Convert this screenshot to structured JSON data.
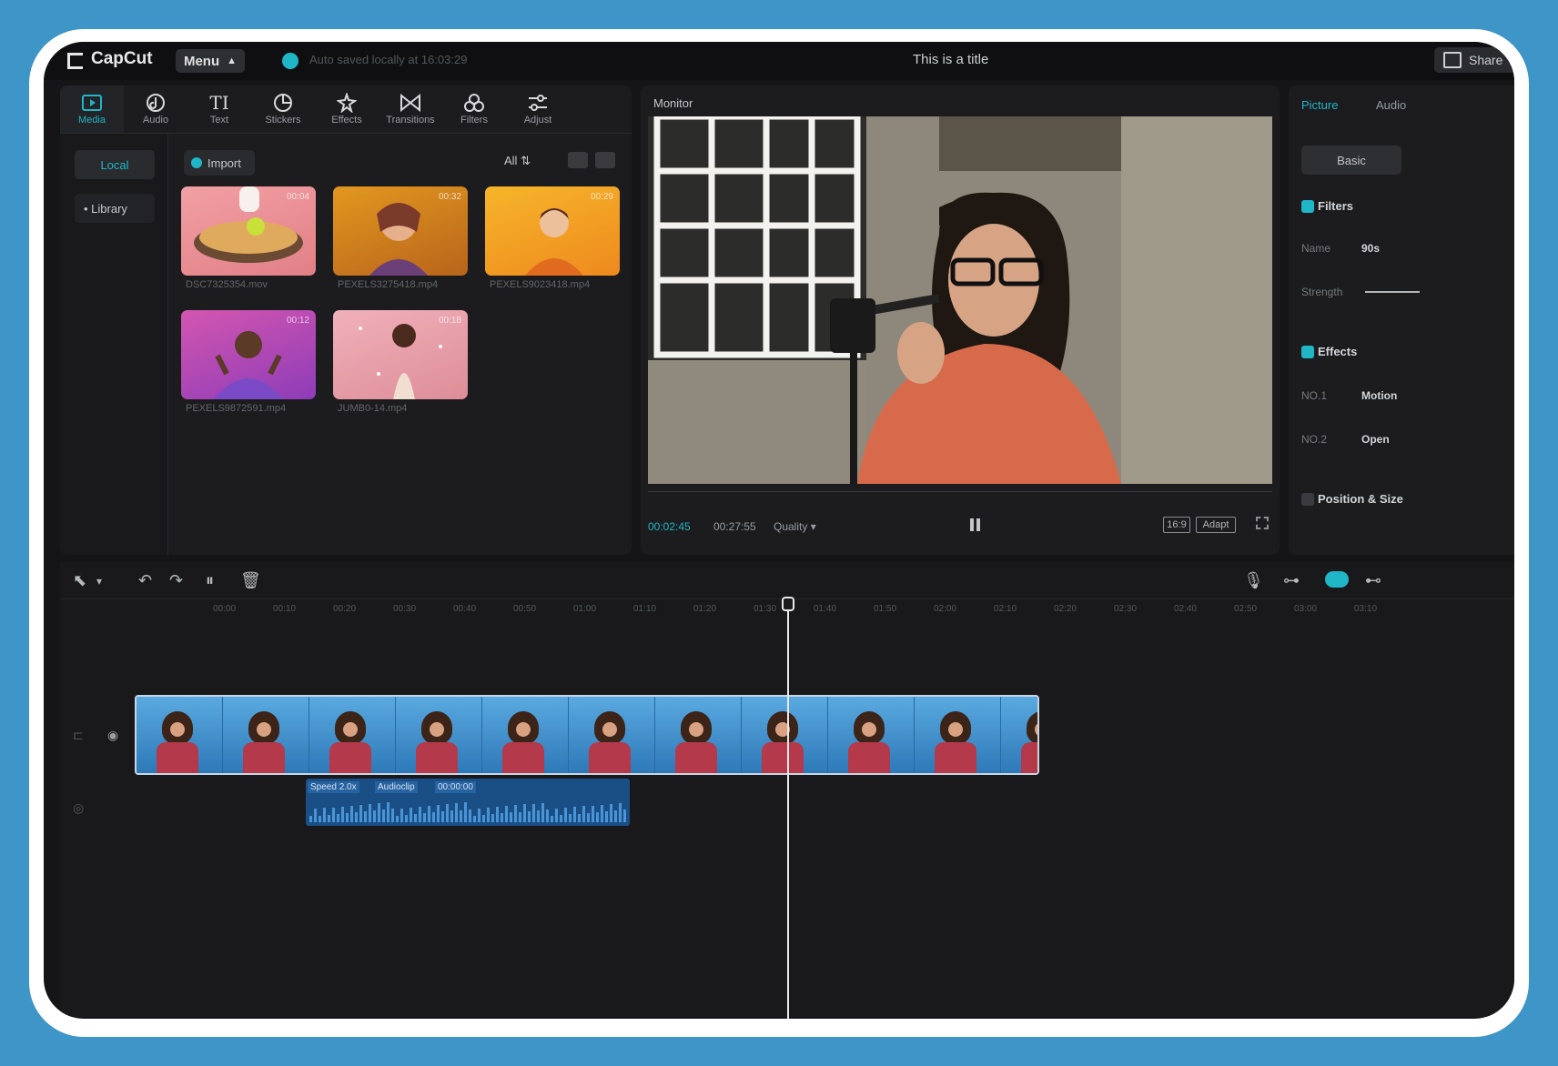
{
  "app": {
    "name": "CapCut",
    "menu_label": "Menu",
    "save_status": "Auto saved locally at 16:03:29",
    "project_title": "This is a title",
    "share_label": "Share"
  },
  "toolbar": {
    "items": [
      {
        "label": "Media",
        "icon": "media-icon"
      },
      {
        "label": "Audio",
        "icon": "audio-icon"
      },
      {
        "label": "Text",
        "icon": "text-icon"
      },
      {
        "label": "Stickers",
        "icon": "stickers-icon"
      },
      {
        "label": "Effects",
        "icon": "effects-icon"
      },
      {
        "label": "Transitions",
        "icon": "transitions-icon"
      },
      {
        "label": "Filters",
        "icon": "filters-icon"
      },
      {
        "label": "Adjust",
        "icon": "adjust-icon"
      }
    ],
    "active": "Media"
  },
  "media": {
    "tabs": {
      "local": "Local",
      "library": "• Library"
    },
    "import_label": "Import",
    "filter_label": "All",
    "items": [
      {
        "name": "DSC7325354.mov",
        "duration": "00:04",
        "colors": [
          "#e88a8e",
          "#d7a16a"
        ]
      },
      {
        "name": "PEXELS3275418.mp4",
        "duration": "00:32",
        "colors": [
          "#d68a1c",
          "#a84a2e"
        ]
      },
      {
        "name": "PEXELS9023418.mp4",
        "duration": "00:29",
        "colors": [
          "#f2a31c",
          "#e2742a"
        ]
      },
      {
        "name": "PEXELS9872591.mp4",
        "duration": "00:12",
        "colors": [
          "#c84ca8",
          "#7e3bb2"
        ]
      },
      {
        "name": "JUMB0-14.mp4",
        "duration": "00:18",
        "colors": [
          "#eaa4b0",
          "#d98891"
        ]
      }
    ]
  },
  "monitor": {
    "label": "Monitor",
    "time_current": "00:02:45",
    "time_total": "00:27:55",
    "quality_label": "Quality",
    "ratio_label": "16:9",
    "adapt_label": "Adapt"
  },
  "inspector": {
    "tabs": [
      "Picture",
      "Audio"
    ],
    "basic_label": "Basic",
    "filters_label": "Filters",
    "name_label": "Name",
    "name_value": "90s",
    "strength_label": "Strength",
    "effects_label": "Effects",
    "no1_label": "NO.1",
    "no1_value": "Motion",
    "no2_label": "NO.2",
    "no2_value": "Open",
    "position_label": "Position & Size"
  },
  "timeline": {
    "ruler": [
      "00:00",
      "00:10",
      "00:20",
      "00:30",
      "00:40",
      "00:50",
      "01:00",
      "01:10",
      "01:20",
      "01:30",
      "01:40",
      "01:50",
      "02:00",
      "02:10",
      "02:20",
      "02:30",
      "02:40",
      "02:50",
      "03:00",
      "03:10"
    ],
    "audio_labels": [
      "Speed 2.0x",
      "Audioclip",
      "00:00:00"
    ]
  },
  "colors": {
    "accent": "#1fb6c7",
    "background": "#151517",
    "frame_blue": "#3d95c8"
  }
}
